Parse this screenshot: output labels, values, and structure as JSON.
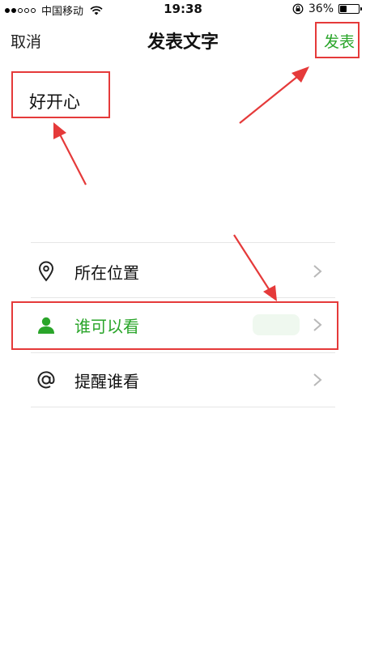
{
  "status_bar": {
    "carrier": "中国移动",
    "time": "19:38",
    "battery": "36%",
    "battery_level": 0.36
  },
  "nav": {
    "cancel_label": "取消",
    "title": "发表文字",
    "post_label": "发表"
  },
  "compose": {
    "text": "好开心"
  },
  "options": [
    {
      "label": "所在位置",
      "icon": "location-pin-icon"
    },
    {
      "label": "谁可以看",
      "icon": "person-icon"
    },
    {
      "label": "提醒谁看",
      "icon": "at-sign-icon"
    }
  ],
  "colors": {
    "accent_green": "#2aa52a",
    "annotation_red": "#e53a3a",
    "divider": "#e6e6e6",
    "chevron": "#b8b8b8"
  }
}
